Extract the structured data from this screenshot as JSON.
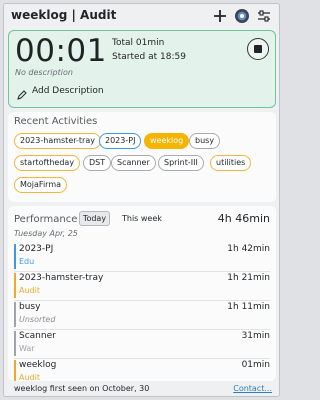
{
  "window": {
    "title": "weeklog | Audit",
    "icons": [
      "plus-icon",
      "record-icon",
      "settings-sliders-icon"
    ]
  },
  "timer": {
    "elapsed": "00:01",
    "total": "Total 01min",
    "started": "Started at 18:59",
    "description_placeholder": "No description",
    "add_description_label": "Add Description",
    "stop_icon": "stop-icon",
    "accent": "#6ec59a"
  },
  "recent": {
    "title": "Recent Activities",
    "chips": [
      {
        "label": "2023-hamster-tray",
        "style": "orange"
      },
      {
        "label": "2023-PJ",
        "style": "blue"
      },
      {
        "label": "weeklog",
        "style": "selected"
      },
      {
        "label": "busy",
        "style": "gray"
      },
      {
        "label": "startoftheday",
        "style": "orange"
      },
      {
        "label": "DST",
        "style": "gray"
      },
      {
        "label": "Scanner",
        "style": "gray"
      },
      {
        "label": "Sprint-III",
        "style": "gray"
      },
      {
        "label": "utilities",
        "style": "orange"
      },
      {
        "label": "MojaFirma",
        "style": "orange"
      }
    ],
    "colors": {
      "orange": "#f0b640",
      "blue": "#3d9ae0",
      "gray": "#a8abaf",
      "selected": "#f5b400"
    }
  },
  "performance": {
    "title": "Performance",
    "tabs": {
      "today": "Today",
      "week": "This week"
    },
    "total": "4h 46min",
    "date": "Tuesday Apr, 25",
    "rows": [
      {
        "name": "2023-PJ",
        "category": "Edu",
        "duration": "1h 42min",
        "color": "#3d9ae0"
      },
      {
        "name": "2023-hamster-tray",
        "category": "Audit",
        "duration": "1h 21min",
        "color": "#f0a92e"
      },
      {
        "name": "busy",
        "category": "Unsorted",
        "duration": "1h 11min",
        "color": "#a0a3a7"
      },
      {
        "name": "Scanner",
        "category": "War",
        "duration": "31min",
        "color": "#a0a3a7"
      },
      {
        "name": "weeklog",
        "category": "Audit",
        "duration": "01min",
        "color": "#f0a92e"
      }
    ]
  },
  "footer": {
    "first_seen": "weeklog first seen on October, 30",
    "contact": "Contact..."
  }
}
